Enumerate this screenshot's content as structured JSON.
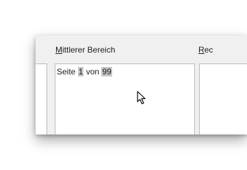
{
  "sections": {
    "center_label": "Mittlerer Bereich",
    "right_label": "Rec"
  },
  "center_field": {
    "prefix": "Seite ",
    "page_field": "1",
    "middle": " von ",
    "pages_field": "99"
  },
  "colors": {
    "dialog_bg": "#f0f0f0",
    "field_highlight": "#c8c8c8"
  }
}
